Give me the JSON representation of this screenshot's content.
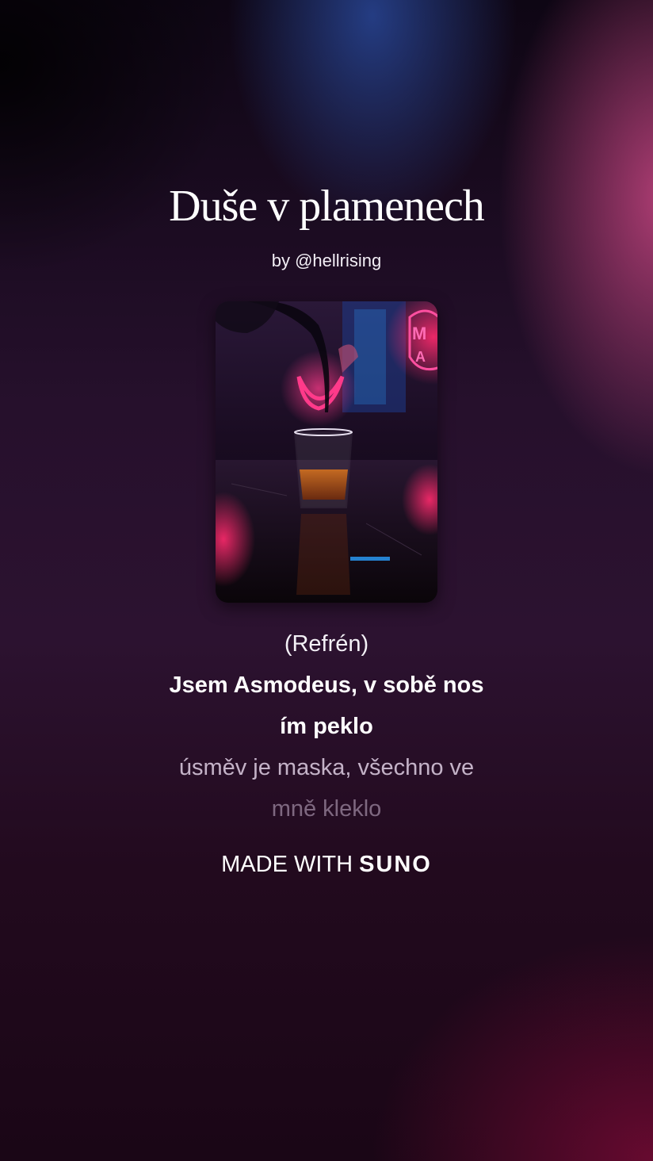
{
  "song": {
    "title": "Duše v plamenech",
    "byline": "by @hellrising"
  },
  "cover": {
    "description_icon": "cover-art-image",
    "neon_text": "M A",
    "colors": {
      "neon_pink": "#ff2a6d",
      "neon_blue": "#2aa0ff",
      "liquid": "#b5571a"
    }
  },
  "lyrics": {
    "section": "(Refrén)",
    "active_line_1": "Jsem Asmodeus, v sobě nos",
    "active_line_2": "ím peklo",
    "next_line_1": "úsměv je maska, všechno ve",
    "next_line_2": "mně kleklo"
  },
  "footer": {
    "made_with": "MADE WITH",
    "brand": "SUNO"
  }
}
